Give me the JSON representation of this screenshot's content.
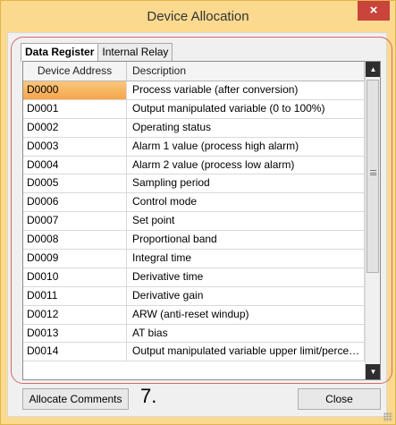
{
  "window": {
    "title": "Device Allocation",
    "close_glyph": "×"
  },
  "tabs": [
    {
      "label": "Data Register",
      "active": true
    },
    {
      "label": "Internal Relay",
      "active": false
    }
  ],
  "grid": {
    "columns": [
      "Device Address",
      "Description"
    ],
    "selected_row": 0,
    "rows": [
      {
        "address": "D0000",
        "description": "Process variable (after conversion)"
      },
      {
        "address": "D0001",
        "description": "Output manipulated variable (0 to 100%)"
      },
      {
        "address": "D0002",
        "description": "Operating status"
      },
      {
        "address": "D0003",
        "description": "Alarm 1 value (process high alarm)"
      },
      {
        "address": "D0004",
        "description": "Alarm 2 value (process low alarm)"
      },
      {
        "address": "D0005",
        "description": "Sampling period"
      },
      {
        "address": "D0006",
        "description": "Control mode"
      },
      {
        "address": "D0007",
        "description": "Set point"
      },
      {
        "address": "D0008",
        "description": "Proportional band"
      },
      {
        "address": "D0009",
        "description": "Integral time"
      },
      {
        "address": "D0010",
        "description": "Derivative time"
      },
      {
        "address": "D0011",
        "description": "Derivative gain"
      },
      {
        "address": "D0012",
        "description": "ARW (anti-reset windup)"
      },
      {
        "address": "D0013",
        "description": "AT bias"
      },
      {
        "address": "D0014",
        "description": "Output manipulated variable upper limit/percenta..."
      }
    ]
  },
  "buttons": {
    "allocate_label": "Allocate Comments",
    "close_label": "Close"
  },
  "callout_label": "7.",
  "colors": {
    "title_bar": "#fbd98e",
    "close_button": "#c9443b",
    "selected_cell": "#f5a64a",
    "highlight_frame": "#d46a6a"
  }
}
